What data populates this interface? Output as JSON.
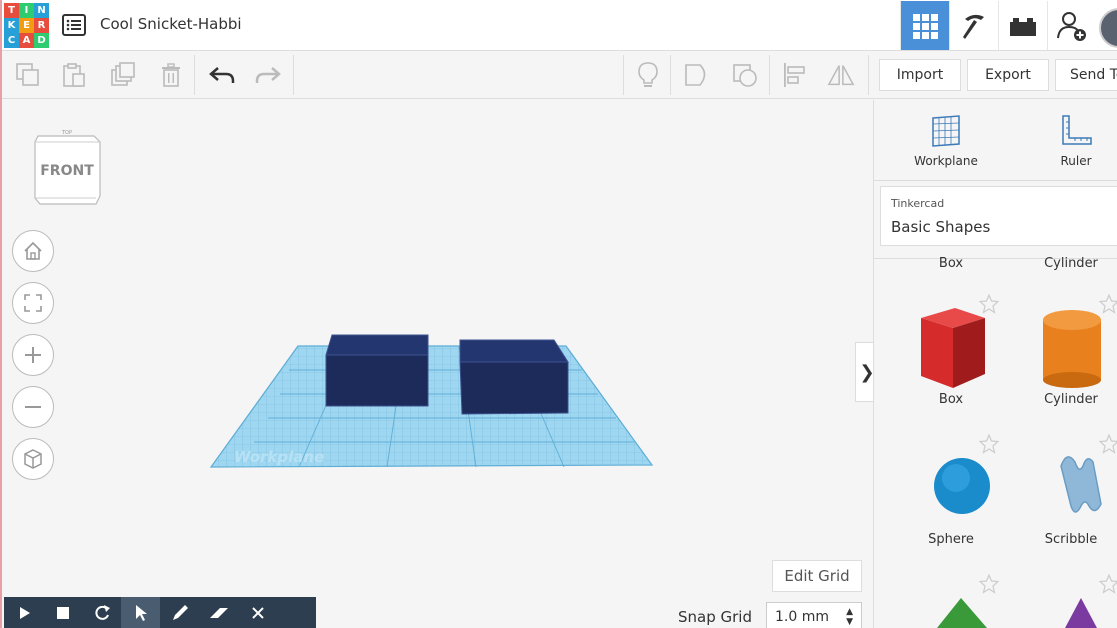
{
  "logo": {
    "letters": [
      "T",
      "I",
      "N",
      "K",
      "E",
      "R",
      "C",
      "A",
      "D"
    ],
    "colors": [
      "#e74c3c",
      "#2ecc71",
      "#27a0d8",
      "#27a0d8",
      "#f39c12",
      "#e74c3c",
      "#27a0d8",
      "#e74c3c",
      "#2ecc71"
    ]
  },
  "header": {
    "title": "Cool Snicket-Habbi",
    "menu_icon": "list-icon"
  },
  "top_nav": {
    "icons": [
      "grid-icon",
      "pickaxe-icon",
      "brick-icon",
      "add-user-icon"
    ],
    "accent": "#4a90d9"
  },
  "toolbar": {
    "import_label": "Import",
    "export_label": "Export",
    "send_label": "Send To"
  },
  "viewport": {
    "cube_label": "FRONT",
    "cube_top_label": "TOP",
    "workplane_label": "Workplane",
    "edit_grid_label": "Edit Grid",
    "snap_label": "Snap Grid",
    "snap_value": "1.0 mm",
    "collapse_glyph": "❯"
  },
  "panel": {
    "workplane_label": "Workplane",
    "ruler_label": "Ruler",
    "library_caption": "Tinkercad",
    "library_value": "Basic Shapes",
    "partial_labels": [
      "Box",
      "Cylinder"
    ],
    "shapes": [
      {
        "name": "Box",
        "color": "#d52b2b"
      },
      {
        "name": "Cylinder",
        "color": "#e8801e"
      },
      {
        "name": "Sphere",
        "color": "#1a8ccc"
      },
      {
        "name": "Scribble",
        "color": "#8fb8d8"
      }
    ]
  },
  "scene_colors": {
    "grid": "#8fd0ec",
    "box": "#1c2b59"
  }
}
